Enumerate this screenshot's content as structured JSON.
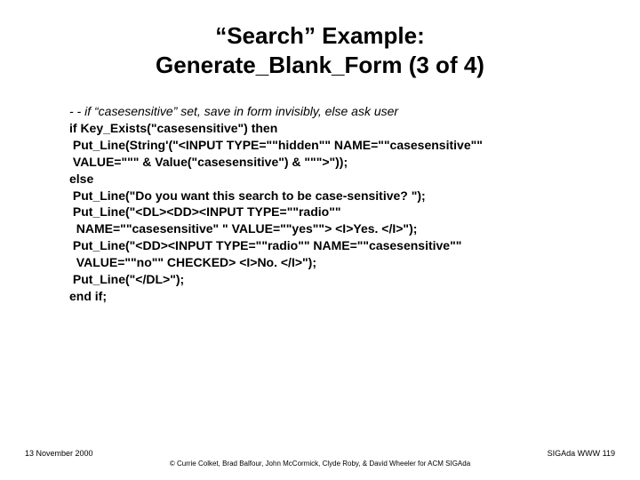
{
  "title": "“Search” Example:\nGenerate_Blank_Form (3 of 4)",
  "comment": "- - if “casesensitive” set, save in form invisibly, else ask user",
  "code": "if Key_Exists(\"casesensitive\") then\n Put_Line(String'(\"<INPUT TYPE=\"\"hidden\"\" NAME=\"\"casesensitive\"\"\n VALUE=\"\"\" & Value(\"casesensitive\") & \"\"\">\"));\nelse\n Put_Line(\"Do you want this search to be case-sensitive? \");\n Put_Line(\"<DL><DD><INPUT TYPE=\"\"radio\"\"\n  NAME=\"\"casesensitive\" \" VALUE=\"\"yes\"\"> <I>Yes. </I>\");\n Put_Line(\"<DD><INPUT TYPE=\"\"radio\"\" NAME=\"\"casesensitive\"\"\n  VALUE=\"\"no\"\" CHECKED> <I>No. </I>\");\n Put_Line(\"</DL>\");\nend if;",
  "footer": {
    "date": "13 November 2000",
    "pageref": "SIGAda WWW 119",
    "copyright": "© Currie Colket, Brad Balfour, John McCormick, Clyde Roby, & David Wheeler for ACM SIGAda"
  }
}
